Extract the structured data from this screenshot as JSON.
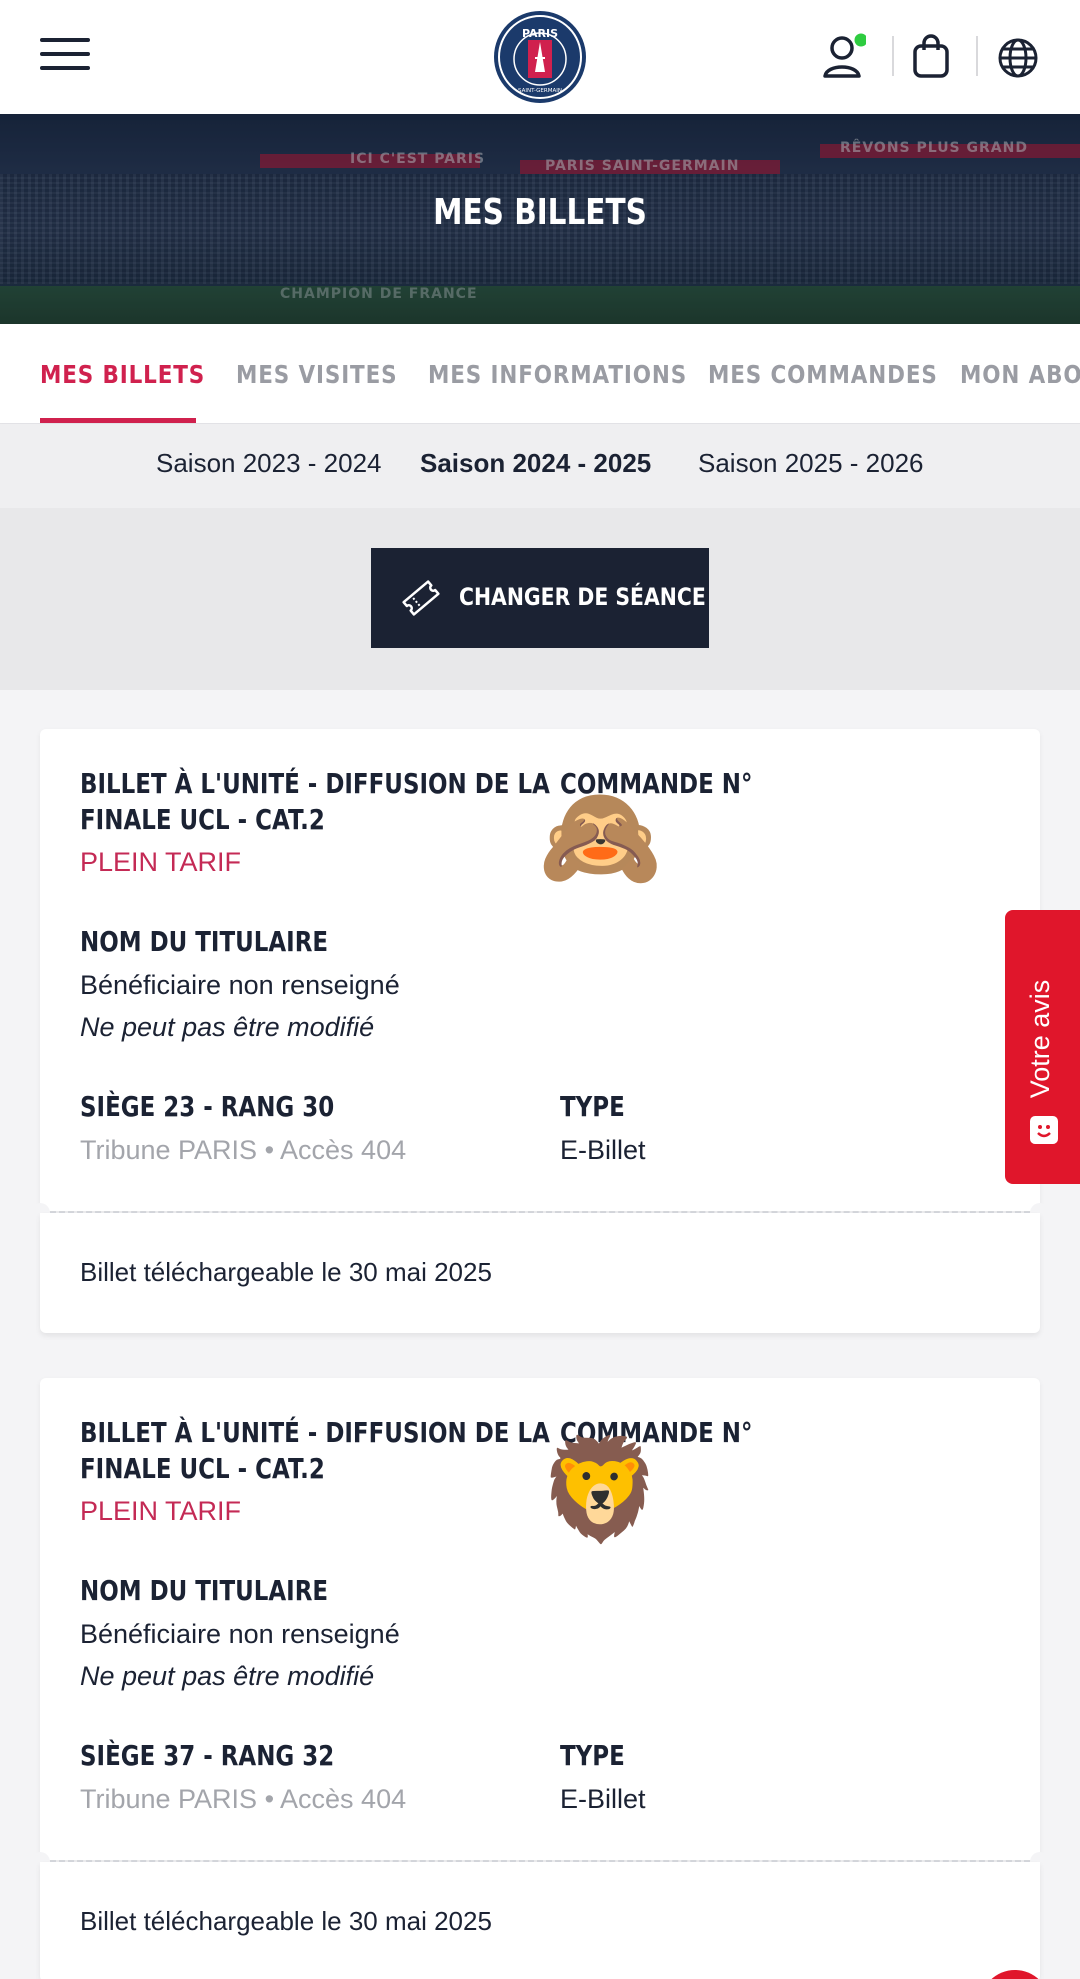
{
  "header": {
    "menu_icon": "hamburger-icon",
    "logo_text_top": "PARIS",
    "logo_text_bottom": "SAINT-GERMAIN",
    "icons": [
      "account-icon",
      "bag-icon",
      "globe-icon"
    ],
    "account_status_color": "#2ecc40"
  },
  "banner": {
    "title": "MES BILLETS",
    "stand_texts": [
      "ICI C'EST PARIS",
      "PARIS SAINT-GERMAIN",
      "RÊVONS PLUS GRAND",
      "CHAMPION DE FRANCE"
    ]
  },
  "tabs": [
    {
      "label": "MES BILLETS",
      "active": true
    },
    {
      "label": "MES VISITES",
      "active": false
    },
    {
      "label": "MES INFORMATIONS",
      "active": false
    },
    {
      "label": "MES COMMANDES",
      "active": false
    },
    {
      "label": "MON ABONNEMENT",
      "active": false
    }
  ],
  "seasons": [
    {
      "label": "Saison 2023 - 2024",
      "active": false
    },
    {
      "label": "Saison 2024 - 2025",
      "active": true
    },
    {
      "label": "Saison 2025 - 2026",
      "active": false
    }
  ],
  "change_button": {
    "label": "CHANGER DE SÉANCE",
    "icon": "ticket-icon"
  },
  "tickets": [
    {
      "title_line1": "BILLET À L'UNITÉ - DIFFUSION DE LA",
      "title_line2": "FINALE UCL - CAT.2",
      "tarif": "PLEIN TARIF",
      "order_label": "COMMANDE N°",
      "order_emoji": "🙈",
      "holder_label": "NOM DU TITULAIRE",
      "holder_value": "Bénéficiaire non renseigné",
      "holder_note": "Ne peut pas être modifié",
      "seat_label": "SIÈGE 23 - RANG 30",
      "seat_location": "Tribune PARIS • Accès 404",
      "type_label": "TYPE",
      "type_value": "E-Billet",
      "download_info": "Billet téléchargeable le 30 mai 2025"
    },
    {
      "title_line1": "BILLET À L'UNITÉ - DIFFUSION DE LA",
      "title_line2": "FINALE UCL - CAT.2",
      "tarif": "PLEIN TARIF",
      "order_label": "COMMANDE N°",
      "order_emoji": "🦁",
      "holder_label": "NOM DU TITULAIRE",
      "holder_value": "Bénéficiaire non renseigné",
      "holder_note": "Ne peut pas être modifié",
      "seat_label": "SIÈGE 37 - RANG 32",
      "seat_location": "Tribune PARIS • Accès 404",
      "type_label": "TYPE",
      "type_value": "E-Billet",
      "download_info": "Billet téléchargeable le 30 mai 2025"
    }
  ],
  "feedback": {
    "label": "Votre avis",
    "color": "#e0162b"
  },
  "colors": {
    "accent": "#d0214e",
    "navy": "#1b2233"
  }
}
